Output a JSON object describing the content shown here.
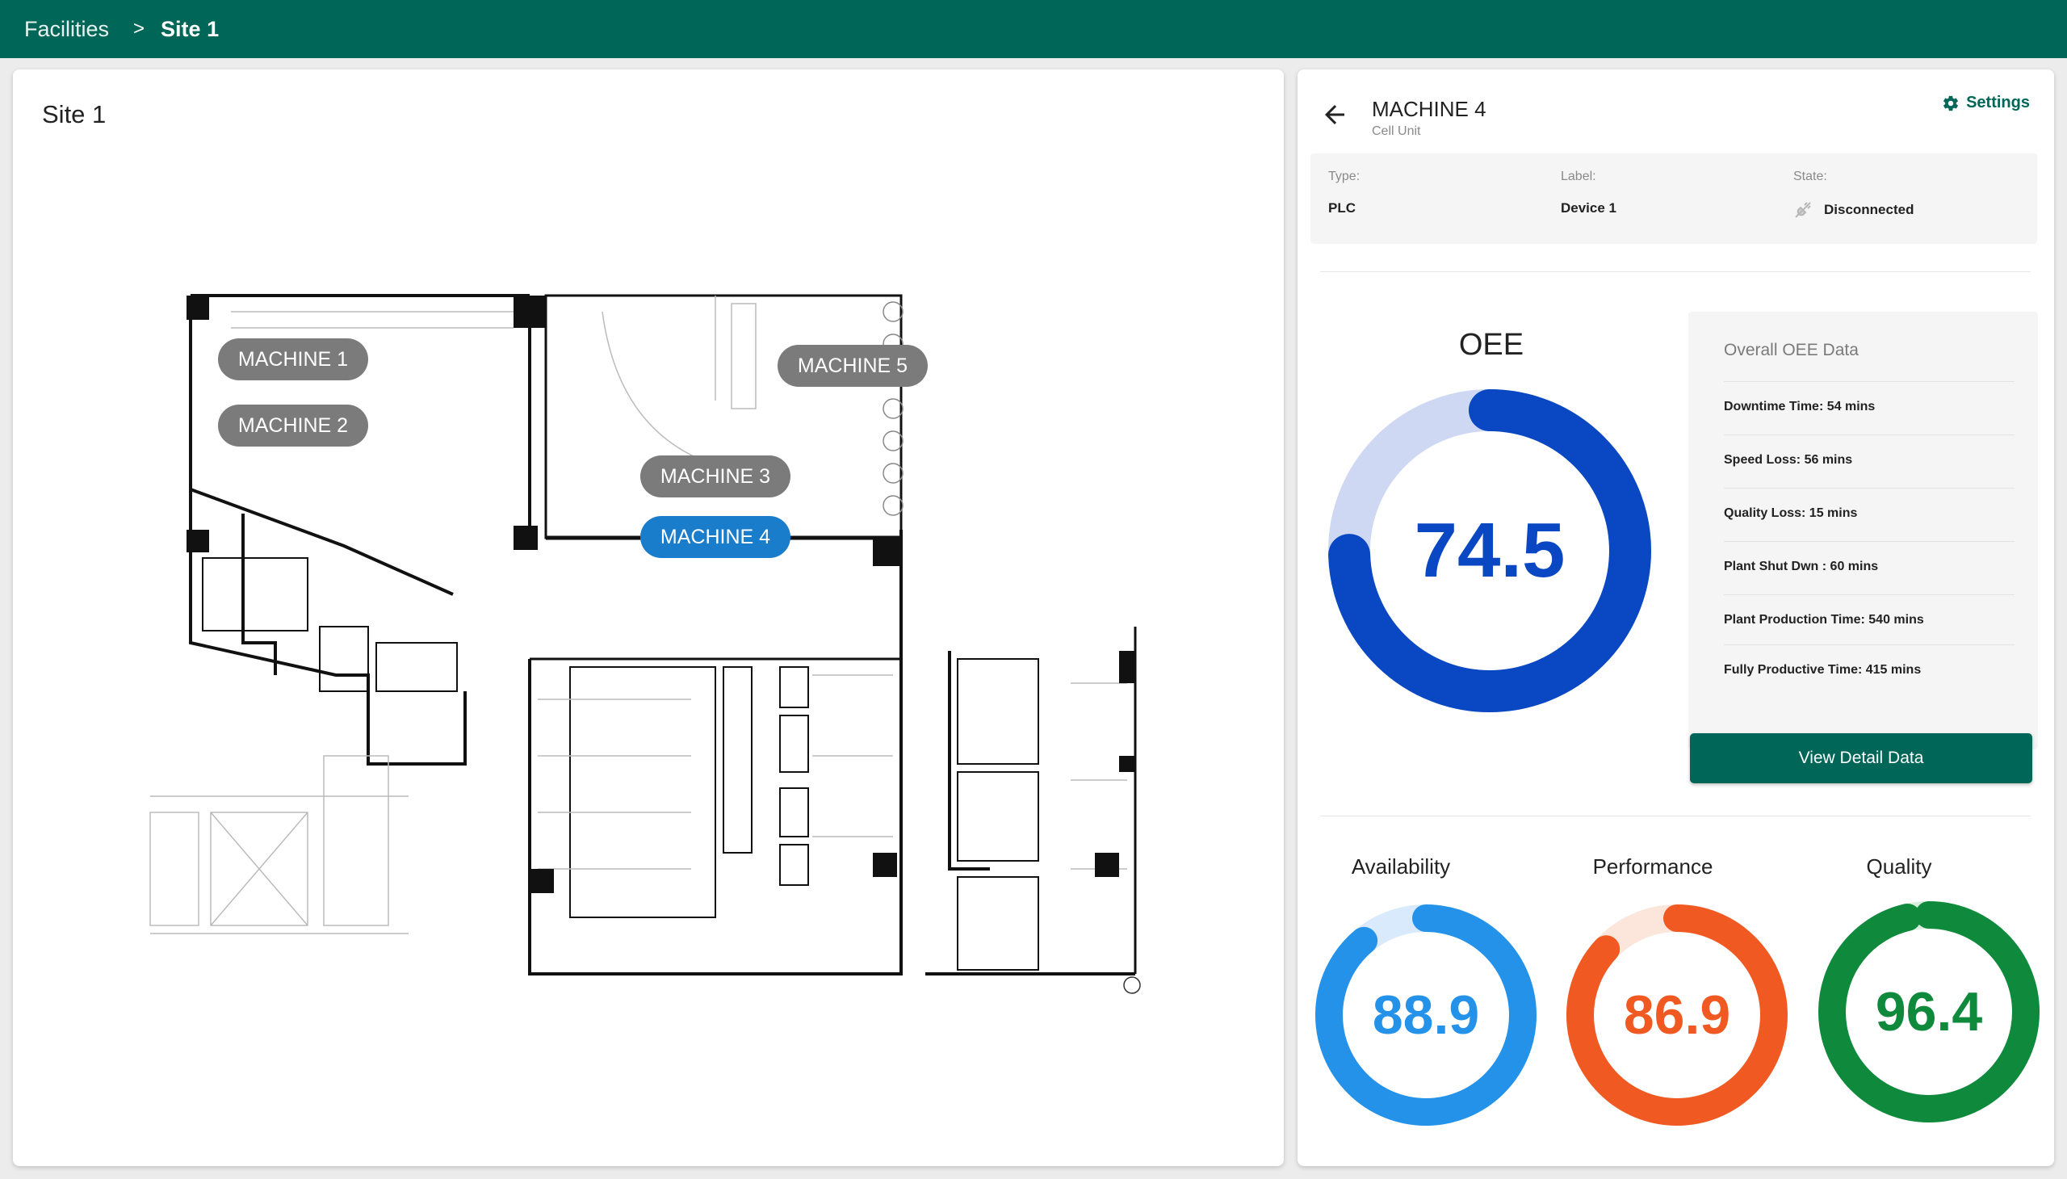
{
  "breadcrumb": {
    "parent": "Facilities",
    "separator": ">",
    "current": "Site 1"
  },
  "site": {
    "title": "Site 1",
    "machines": [
      {
        "label": "MACHINE 1",
        "active": false
      },
      {
        "label": "MACHINE 2",
        "active": false
      },
      {
        "label": "MACHINE 3",
        "active": false
      },
      {
        "label": "MACHINE 4",
        "active": true
      },
      {
        "label": "MACHINE 5",
        "active": false
      }
    ]
  },
  "detail": {
    "title": "MACHINE 4",
    "subtitle": "Cell Unit",
    "settings_label": "Settings",
    "info": {
      "type_label": "Type:",
      "type_value": "PLC",
      "label_label": "Label:",
      "label_value": "Device 1",
      "state_label": "State:",
      "state_value": "Disconnected"
    },
    "oee": {
      "label": "OEE",
      "value": "74.5",
      "percent": 74.5,
      "color": "#0a47c2",
      "track_color": "#cfd8f2"
    },
    "overall": {
      "title": "Overall OEE Data",
      "rows": [
        "Downtime Time: 54 mins",
        "Speed Loss: 56 mins",
        "Quality Loss: 15 mins",
        "Plant Shut Dwn : 60 mins",
        "Plant Production Time: 540 mins",
        "Fully Productive Time: 415 mins"
      ]
    },
    "view_button": "View Detail Data",
    "metrics": [
      {
        "label": "Availability",
        "value": "88.9",
        "percent": 88.9,
        "color": "#2592ea",
        "track_color": "#d8eafb"
      },
      {
        "label": "Performance",
        "value": "86.9",
        "percent": 86.9,
        "color": "#f05a22",
        "track_color": "#fce6dc"
      },
      {
        "label": "Quality",
        "value": "96.4",
        "percent": 96.4,
        "color": "#0f8a3c",
        "track_color": "#d6eedc"
      }
    ]
  },
  "colors": {
    "brand": "#006758",
    "active_machine": "#1a7dcc",
    "inactive_machine": "#7b7b7b"
  }
}
